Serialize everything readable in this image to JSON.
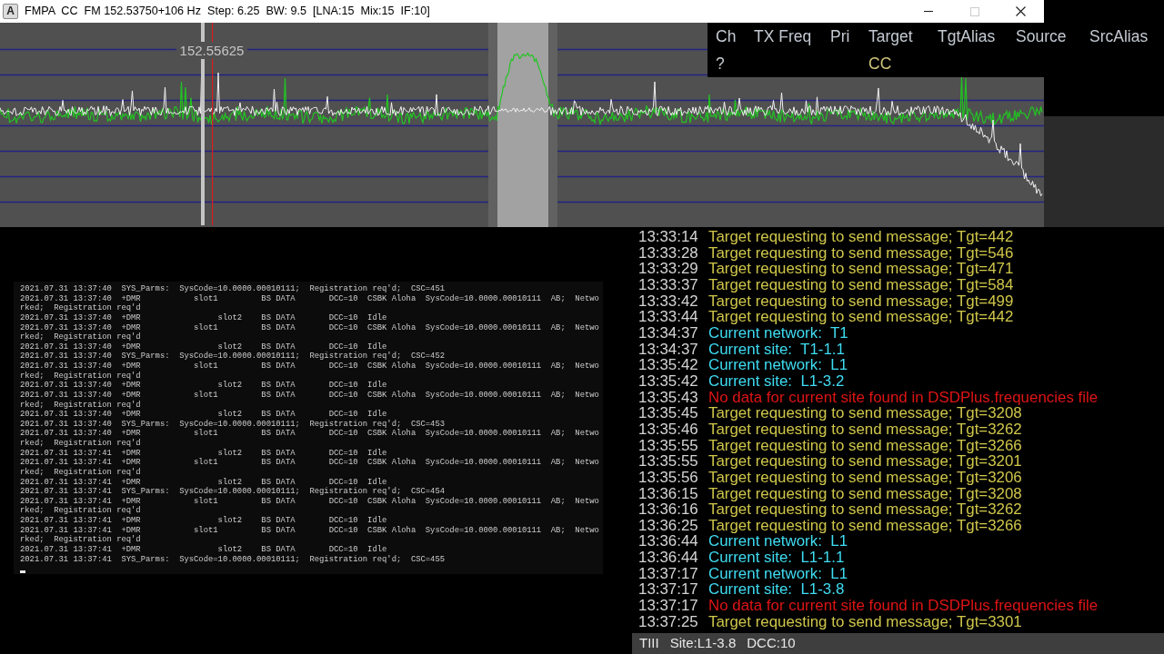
{
  "window": {
    "app_icon_letter": "A",
    "title": "FMPA  CC  FM 152.53750+106 Hz  Step: 6.25  BW: 9.5  [LNA:15  Mix:15  IF:10]",
    "controls": [
      {
        "kind": "minimize",
        "disabled": false
      },
      {
        "kind": "maximize",
        "disabled": true
      },
      {
        "kind": "close",
        "disabled": false
      }
    ]
  },
  "spectrum": {
    "marker_label": "152.55625"
  },
  "channel_table": {
    "columns": [
      "Ch",
      "TX Freq",
      "Pri",
      "Target",
      "TgtAlias",
      "Source",
      "SrcAlias"
    ],
    "rows": [
      {
        "ch": "?",
        "target": "CC"
      }
    ]
  },
  "console": {
    "lines": [
      "2021.07.31 13:37:40  SYS_Parms:  SysCode=10.0000.00010111;  Registration req'd;  CSC=451",
      "2021.07.31 13:37:40  +DMR           slot1         BS DATA       DCC=10  CSBK Aloha  SysCode=10.0000.00010111  AB;  Netwo",
      "rked;  Registration req'd",
      "2021.07.31 13:37:40  +DMR                slot2    BS DATA       DCC=10  Idle",
      "2021.07.31 13:37:40  +DMR           slot1         BS DATA       DCC=10  CSBK Aloha  SysCode=10.0000.00010111  AB;  Netwo",
      "rked;  Registration req'd",
      "2021.07.31 13:37:40  +DMR                slot2    BS DATA       DCC=10  Idle",
      "2021.07.31 13:37:40  SYS_Parms:  SysCode=10.0000.00010111;  Registration req'd;  CSC=452",
      "2021.07.31 13:37:40  +DMR           slot1         BS DATA       DCC=10  CSBK Aloha  SysCode=10.0000.00010111  AB;  Netwo",
      "rked;  Registration req'd",
      "2021.07.31 13:37:40  +DMR                slot2    BS DATA       DCC=10  Idle",
      "2021.07.31 13:37:40  +DMR           slot1         BS DATA       DCC=10  CSBK Aloha  SysCode=10.0000.00010111  AB;  Netwo",
      "rked;  Registration req'd",
      "2021.07.31 13:37:40  +DMR                slot2    BS DATA       DCC=10  Idle",
      "2021.07.31 13:37:40  SYS_Parms:  SysCode=10.0000.00010111;  Registration req'd;  CSC=453",
      "2021.07.31 13:37:40  +DMR           slot1         BS DATA       DCC=10  CSBK Aloha  SysCode=10.0000.00010111  AB;  Netwo",
      "rked;  Registration req'd",
      "2021.07.31 13:37:41  +DMR                slot2    BS DATA       DCC=10  Idle",
      "2021.07.31 13:37:41  +DMR           slot1         BS DATA       DCC=10  CSBK Aloha  SysCode=10.0000.00010111  AB;  Netwo",
      "rked;  Registration req'd",
      "2021.07.31 13:37:41  +DMR                slot2    BS DATA       DCC=10  Idle",
      "2021.07.31 13:37:41  SYS_Parms:  SysCode=10.0000.00010111;  Registration req'd;  CSC=454",
      "2021.07.31 13:37:41  +DMR           slot1         BS DATA       DCC=10  CSBK Aloha  SysCode=10.0000.00010111  AB;  Netwo",
      "rked;  Registration req'd",
      "2021.07.31 13:37:41  +DMR                slot2    BS DATA       DCC=10  Idle",
      "2021.07.31 13:37:41  +DMR           slot1         BS DATA       DCC=10  CSBK Aloha  SysCode=10.0000.00010111  AB;  Netwo",
      "rked;  Registration req'd",
      "2021.07.31 13:37:41  +DMR                slot2    BS DATA       DCC=10  Idle",
      "2021.07.31 13:37:41  SYS_Parms:  SysCode=10.0000.00010111;  Registration req'd;  CSC=455"
    ]
  },
  "event_log": {
    "entries": [
      {
        "time": "13:33:14",
        "message": "Target requesting to send message; Tgt=442",
        "color": "#cfc64a"
      },
      {
        "time": "13:33:28",
        "message": "Target requesting to send message; Tgt=546",
        "color": "#cfc64a"
      },
      {
        "time": "13:33:29",
        "message": "Target requesting to send message; Tgt=471",
        "color": "#cfc64a"
      },
      {
        "time": "13:33:37",
        "message": "Target requesting to send message; Tgt=584",
        "color": "#cfc64a"
      },
      {
        "time": "13:33:42",
        "message": "Target requesting to send message; Tgt=499",
        "color": "#cfc64a"
      },
      {
        "time": "13:33:44",
        "message": "Target requesting to send message; Tgt=442",
        "color": "#cfc64a"
      },
      {
        "time": "13:34:37",
        "message": "Current network:  T1",
        "color": "#3fdcf2"
      },
      {
        "time": "13:34:37",
        "message": "Current site:  T1-1.1",
        "color": "#3fdcf2"
      },
      {
        "time": "13:35:42",
        "message": "Current network:  L1",
        "color": "#3fdcf2"
      },
      {
        "time": "13:35:42",
        "message": "Current site:  L1-3.2",
        "color": "#3fdcf2"
      },
      {
        "time": "13:35:43",
        "message": "No data for current site found in DSDPlus.frequencies file",
        "color": "#e01414"
      },
      {
        "time": "13:35:45",
        "message": "Target requesting to send message; Tgt=3208",
        "color": "#cfc64a"
      },
      {
        "time": "13:35:46",
        "message": "Target requesting to send message; Tgt=3262",
        "color": "#cfc64a"
      },
      {
        "time": "13:35:55",
        "message": "Target requesting to send message; Tgt=3266",
        "color": "#cfc64a"
      },
      {
        "time": "13:35:55",
        "message": "Target requesting to send message; Tgt=3201",
        "color": "#cfc64a"
      },
      {
        "time": "13:35:56",
        "message": "Target requesting to send message; Tgt=3206",
        "color": "#cfc64a"
      },
      {
        "time": "13:36:15",
        "message": "Target requesting to send message; Tgt=3208",
        "color": "#cfc64a"
      },
      {
        "time": "13:36:16",
        "message": "Target requesting to send message; Tgt=3262",
        "color": "#cfc64a"
      },
      {
        "time": "13:36:25",
        "message": "Target requesting to send message; Tgt=3266",
        "color": "#cfc64a"
      },
      {
        "time": "13:36:44",
        "message": "Current network:  L1",
        "color": "#3fdcf2"
      },
      {
        "time": "13:36:44",
        "message": "Current site:  L1-1.1",
        "color": "#3fdcf2"
      },
      {
        "time": "13:37:17",
        "message": "Current network:  L1",
        "color": "#3fdcf2"
      },
      {
        "time": "13:37:17",
        "message": "Current site:  L1-3.8",
        "color": "#3fdcf2"
      },
      {
        "time": "13:37:17",
        "message": "No data for current site found in DSDPlus.frequencies file",
        "color": "#e01414"
      },
      {
        "time": "13:37:25",
        "message": "Target requesting to send message; Tgt=3301",
        "color": "#cfc64a"
      }
    ]
  },
  "status_bar": {
    "items": [
      "TIII",
      "Site:L1-3.8",
      "DCC:10"
    ]
  }
}
